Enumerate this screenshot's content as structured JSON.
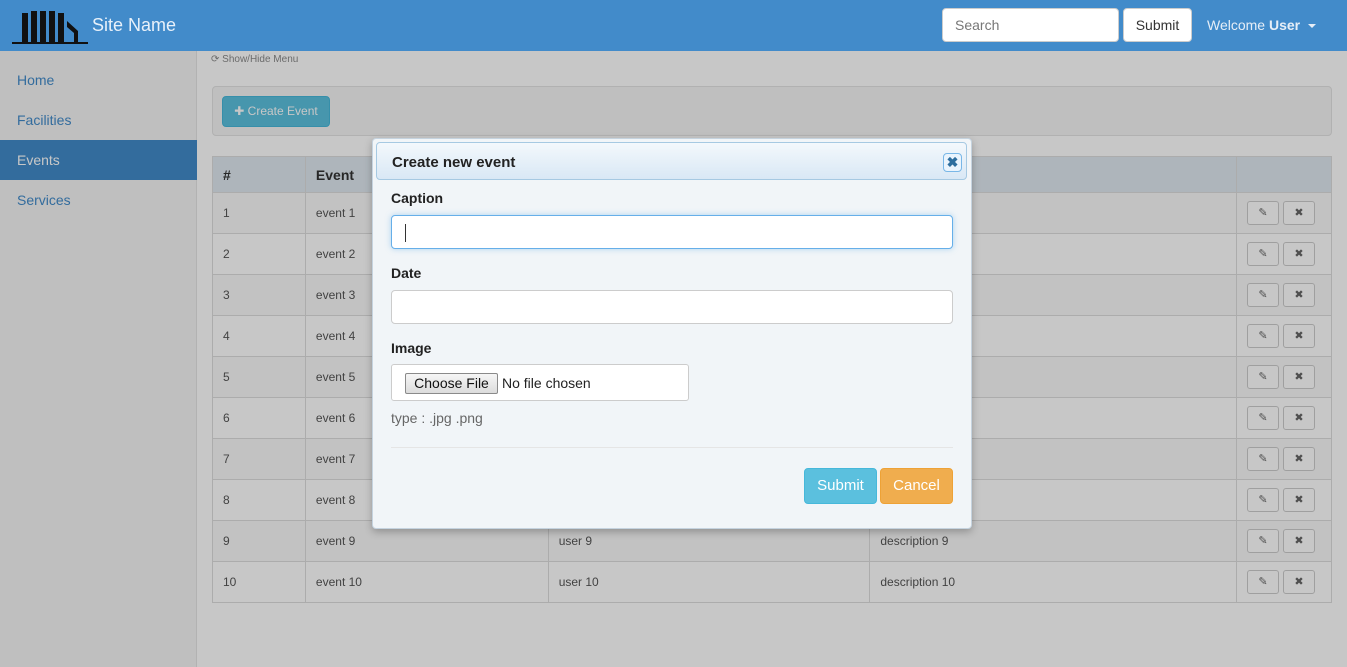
{
  "header": {
    "site_name": "Site Name",
    "search_placeholder": "Search",
    "submit_label": "Submit",
    "welcome_prefix": "Welcome",
    "user_name": "User",
    "background_color": "#428bca"
  },
  "sidebar": {
    "items": [
      {
        "label": "Home",
        "active": false
      },
      {
        "label": "Facilities",
        "active": false
      },
      {
        "label": "Events",
        "active": true
      },
      {
        "label": "Services",
        "active": false
      }
    ]
  },
  "main": {
    "toggle_menu_label": "Show/Hide Menu",
    "create_event_label": "Create Event",
    "table": {
      "headers": [
        "#",
        "Event",
        "",
        "",
        ""
      ],
      "rows": [
        {
          "num": "1",
          "event": "event 1",
          "user": "",
          "description": ""
        },
        {
          "num": "2",
          "event": "event 2",
          "user": "",
          "description": ""
        },
        {
          "num": "3",
          "event": "event 3",
          "user": "",
          "description": ""
        },
        {
          "num": "4",
          "event": "event 4",
          "user": "",
          "description": ""
        },
        {
          "num": "5",
          "event": "event 5",
          "user": "",
          "description": ""
        },
        {
          "num": "6",
          "event": "event 6",
          "user": "",
          "description": ""
        },
        {
          "num": "7",
          "event": "event 7",
          "user": "",
          "description": ""
        },
        {
          "num": "8",
          "event": "event 8",
          "user": "",
          "description": ""
        },
        {
          "num": "9",
          "event": "event 9",
          "user": "user 9",
          "description": "description 9"
        },
        {
          "num": "10",
          "event": "event 10",
          "user": "user 10",
          "description": "description 10"
        }
      ]
    }
  },
  "dialog": {
    "title": "Create new event",
    "caption_label": "Caption",
    "caption_value": "",
    "date_label": "Date",
    "date_value": "",
    "image_label": "Image",
    "choose_file_label": "Choose File",
    "file_status": "No file chosen",
    "help_text": "type : .jpg .png",
    "submit_label": "Submit",
    "cancel_label": "Cancel",
    "icons": {
      "close": "close-icon"
    }
  }
}
